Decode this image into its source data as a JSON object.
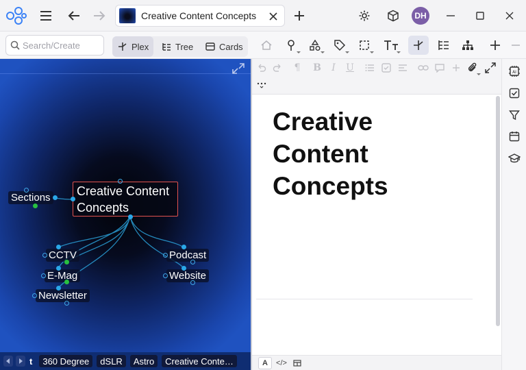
{
  "tab": {
    "title": "Creative Content Concepts"
  },
  "user": {
    "initials": "DH"
  },
  "search": {
    "placeholder": "Search/Create"
  },
  "views": [
    {
      "label": "Plex",
      "active": true
    },
    {
      "label": "Tree",
      "active": false
    },
    {
      "label": "Cards",
      "active": false
    }
  ],
  "map": {
    "main_node": {
      "line1": "Creative Content",
      "line2": "Concepts"
    },
    "nodes": [
      "Sections",
      "CCTV",
      "E-Mag",
      "Newsletter",
      "Podcast",
      "Website"
    ]
  },
  "breadcrumb": [
    "t",
    "360 Degree",
    "dSLR",
    "Astro",
    "Creative Conte…"
  ],
  "document": {
    "title_lines": [
      "Creative",
      "Content",
      "Concepts"
    ]
  },
  "editor_footer": {
    "text_mode": "A",
    "code_mode": "</>"
  },
  "colors": {
    "accent_purple": "#7b5ea7",
    "map_dark": "#060b1f",
    "map_blue": "#1f52c0",
    "node_border_red": "#e3534f",
    "link_cyan": "#2aa7e8",
    "link_green": "#28c040"
  },
  "icons": {
    "titlebar": [
      "logo-icon",
      "menu-icon",
      "back-arrow-icon",
      "forward-arrow-icon",
      "close-icon",
      "plus-icon",
      "gear-icon",
      "cube-icon",
      "minimize-icon",
      "maximize-icon",
      "window-close-icon"
    ],
    "toolbar": [
      "home-icon",
      "pin-icon",
      "shapes-icon",
      "tag-icon",
      "select-icon",
      "text-size-icon",
      "plex-icon",
      "tree-icon",
      "hierarchy-icon",
      "plus-icon",
      "minus-icon"
    ],
    "rail": [
      "ai-icon",
      "checkbox-icon",
      "filter-icon",
      "calendar-icon",
      "graduation-cap-icon"
    ]
  }
}
